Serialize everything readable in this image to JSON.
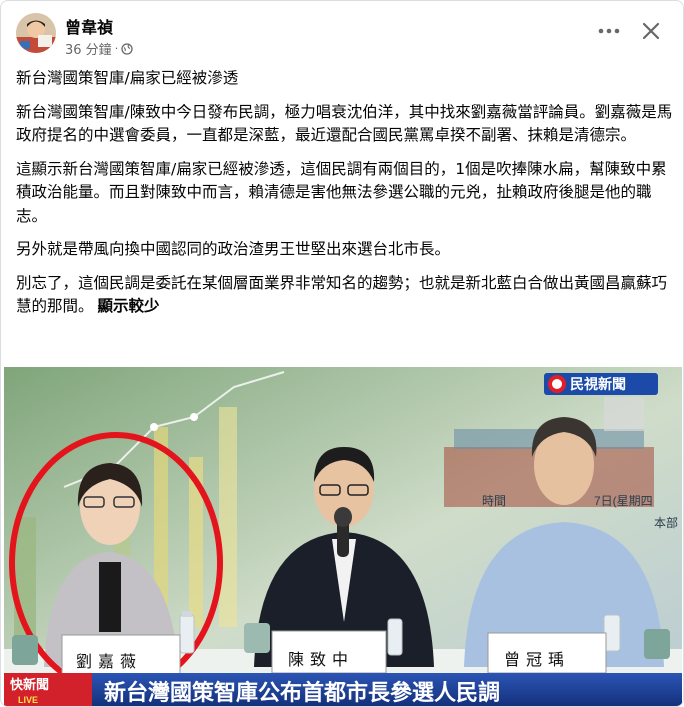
{
  "post": {
    "author": "曾韋禎",
    "time": "36 分鐘",
    "time_sep": "·",
    "more_icon": "more-horizontal-icon",
    "close_icon": "close-icon",
    "paragraphs": [
      "新台灣國策智庫/扁家已經被滲透",
      "新台灣國策智庫/陳致中今日發布民調，極力唱衰沈伯洋，其中找來劉嘉薇當評論員。劉嘉薇是馬政府提名的中選會委員，一直都是深藍，最近還配合國民黨罵卓揆不副署、抹賴是清德宗。",
      "這顯示新台灣國策智庫/扁家已經被滲透，這個民調有兩個目的，1個是吹捧陳水扁，幫陳致中累積政治能量。而且對陳致中而言，賴清德是害他無法參選公職的元兇，扯賴政府後腿是他的職志。",
      "另外就是帶風向換中國認同的政治渣男王世堅出來選台北市長。",
      "別忘了，這個民調是委託在某個層面業界非常知名的趨勢；也就是新北藍白合做出黃國昌贏蘇巧慧的那間。"
    ],
    "see_less": "顯示較少"
  },
  "photo": {
    "logo": "民視新聞",
    "nameplates": [
      "劉嘉薇",
      "陳致中",
      "曾冠瑀"
    ],
    "banner": "新台灣國策智庫公布首都市長參選人民調",
    "banner_tag": "快新聞",
    "live": "LIVE",
    "backdrop_time": "時間",
    "backdrop_date": "7日(星期四",
    "backdrop_place": "本部"
  },
  "colors": {
    "text": "#050505",
    "secondary": "#65676b",
    "banner_blue": "#1d3f93",
    "highlight_red": "#e3141b"
  }
}
